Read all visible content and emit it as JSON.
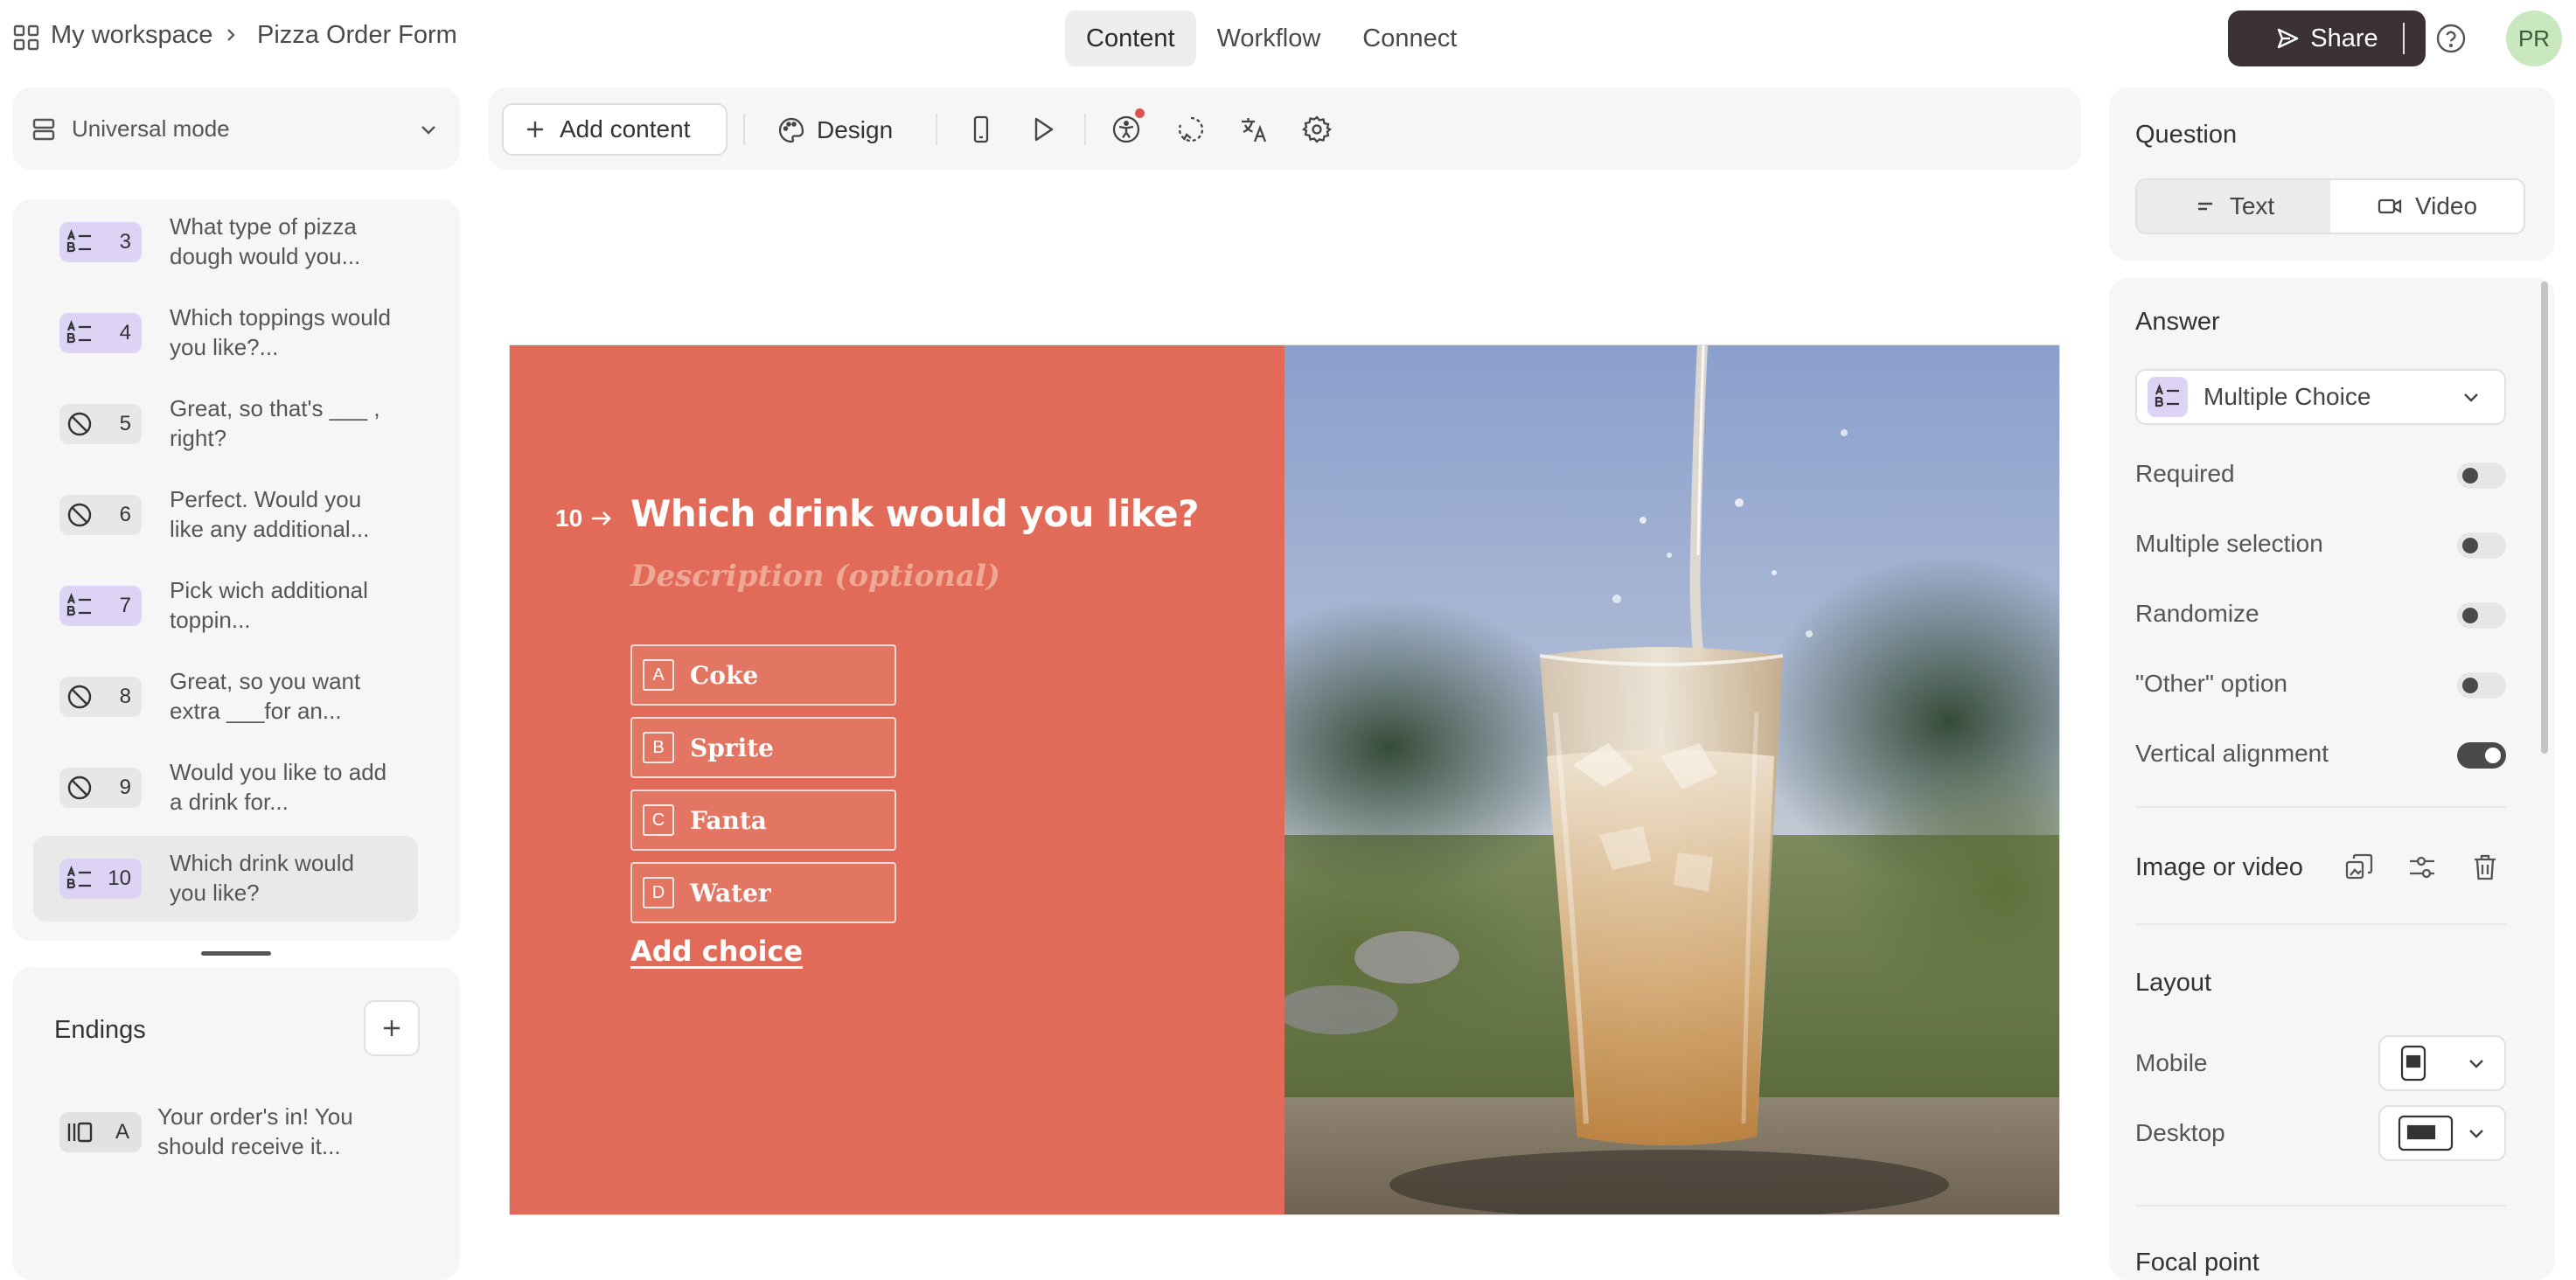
{
  "breadcrumb": {
    "workspace": "My workspace",
    "form": "Pizza Order Form"
  },
  "tabs": [
    {
      "label": "Content",
      "active": true
    },
    {
      "label": "Workflow",
      "active": false
    },
    {
      "label": "Connect",
      "active": false
    }
  ],
  "header": {
    "share_label": "Share",
    "avatar_initials": "PR"
  },
  "sidebar": {
    "mode_label": "Universal mode",
    "questions": [
      {
        "number": "3",
        "text": "What type of pizza dough would you...",
        "kind": "multiple-choice"
      },
      {
        "number": "4",
        "text": "Which toppings would you like?...",
        "kind": "multiple-choice"
      },
      {
        "number": "5",
        "text": "Great, so that's ___ , right?",
        "kind": "statement"
      },
      {
        "number": "6",
        "text": "Perfect. Would you like any additional...",
        "kind": "statement"
      },
      {
        "number": "7",
        "text": "Pick wich additional toppin...",
        "kind": "multiple-choice"
      },
      {
        "number": "8",
        "text": "Great, so you want extra ___for an...",
        "kind": "statement"
      },
      {
        "number": "9",
        "text": "Would you like to add a drink for...",
        "kind": "statement"
      },
      {
        "number": "10",
        "text": "Which drink would you like?",
        "kind": "multiple-choice",
        "active": true
      }
    ],
    "endings_title": "Endings",
    "endings": [
      {
        "key": "A",
        "text": "Your order's in! You should receive it..."
      }
    ]
  },
  "toolbar": {
    "add_content_label": "Add content",
    "design_label": "Design"
  },
  "canvas": {
    "question_number": "10",
    "question_title": "Which drink would you like?",
    "description_placeholder": "Description (optional)",
    "choices": [
      {
        "key": "A",
        "label": "Coke"
      },
      {
        "key": "B",
        "label": "Sprite"
      },
      {
        "key": "C",
        "label": "Fanta"
      },
      {
        "key": "D",
        "label": "Water"
      }
    ],
    "add_choice_label": "Add choice",
    "background_color": "#e16b58"
  },
  "right_panel": {
    "question_title": "Question",
    "question_types": [
      {
        "label": "Text",
        "active": true
      },
      {
        "label": "Video",
        "active": false
      }
    ],
    "answer_title": "Answer",
    "answer_type": "Multiple Choice",
    "settings": [
      {
        "label": "Required",
        "on": false
      },
      {
        "label": "Multiple selection",
        "on": false
      },
      {
        "label": "Randomize",
        "on": false
      },
      {
        "label": "\"Other\" option",
        "on": false
      },
      {
        "label": "Vertical alignment",
        "on": true
      }
    ],
    "image_video_label": "Image or video",
    "layout_title": "Layout",
    "layout_mobile_label": "Mobile",
    "layout_desktop_label": "Desktop",
    "focal_point_label": "Focal point"
  }
}
